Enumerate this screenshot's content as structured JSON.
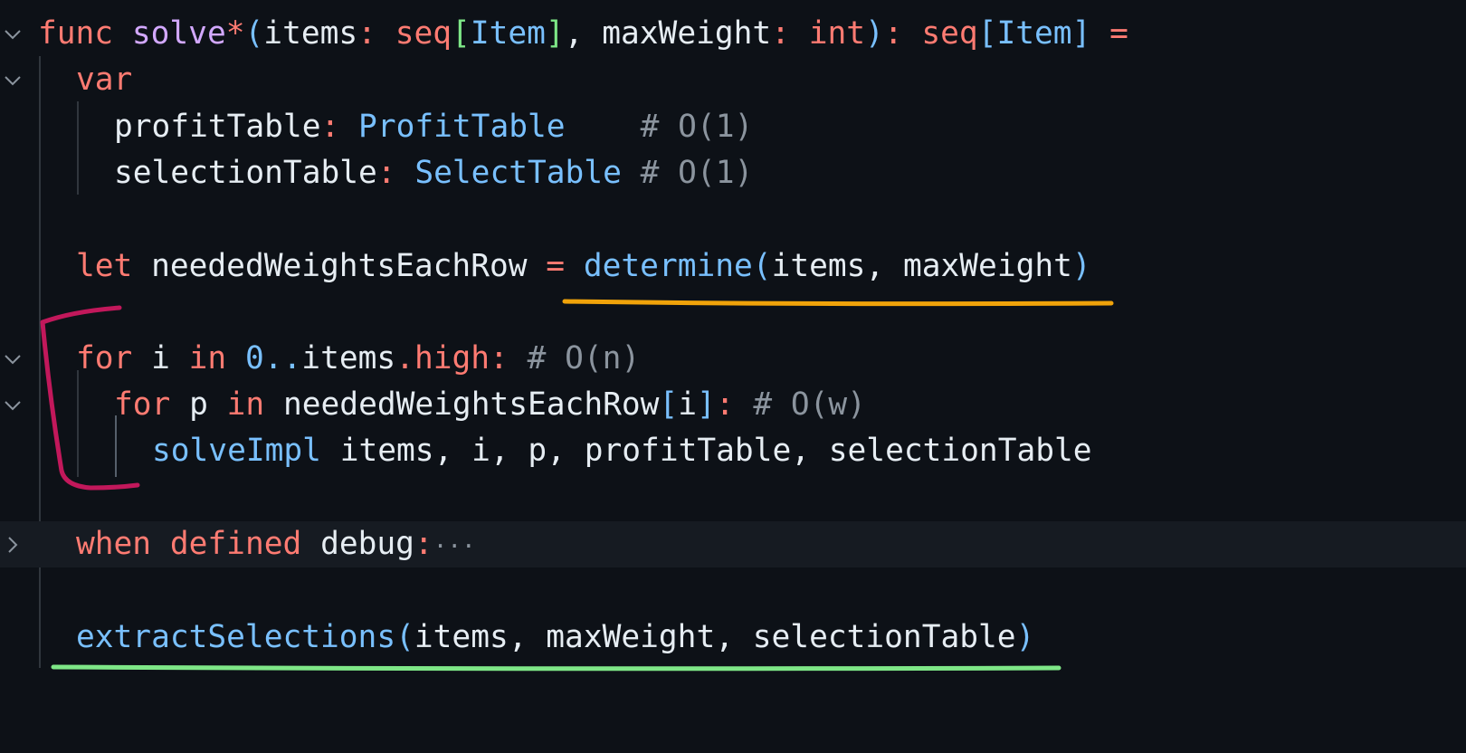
{
  "colors": {
    "background": "#0d1117",
    "keyword": "#ff7b72",
    "function_name": "#d2a8ff",
    "type": "#79c0ff",
    "comment": "#8b949e",
    "identifier": "#e6edf3",
    "annotation_orange": "#f0a30a",
    "annotation_green": "#7ee787",
    "annotation_bracket": "#c2185b"
  },
  "icons": {
    "expanded": "chevron-down-icon",
    "collapsed": "chevron-right-icon"
  },
  "code": {
    "sig": {
      "func": "func",
      "name": "solve",
      "star": "*",
      "p1": "(",
      "items": "items",
      "colon1": ":",
      "seq1": "seq",
      "lb1": "[",
      "item1": "Item",
      "rb1": "]",
      "comma": ", ",
      "maxWeight": "maxWeight",
      "colon2": ":",
      "int": "int",
      "rp": ")",
      "colon3": ":",
      "seq2": "seq",
      "lb2": "[",
      "item2": "Item",
      "rb2": "]",
      "eq": "="
    },
    "var_kw": "var",
    "pt": {
      "name": "profitTable",
      "colon": ":",
      "type": "ProfitTable",
      "pad": "    ",
      "comment": "# O(1)"
    },
    "st": {
      "name": "selectionTable",
      "colon": ":",
      "type": "SelectTable",
      "pad": " ",
      "comment": "# O(1)"
    },
    "let": {
      "kw": "let",
      "name": "neededWeightsEachRow",
      "eq": "=",
      "fn": "determine",
      "p1": "(",
      "args": "items, maxWeight",
      "p2": ")"
    },
    "for1": {
      "kw": "for",
      "var": "i",
      "in": "in",
      "num": "0..",
      "obj": "items",
      "dot": ".",
      "prop": "high",
      "colon": ":",
      "comment": "# O(n)"
    },
    "for2": {
      "kw": "for",
      "var": "p",
      "in": "in",
      "obj": "neededWeightsEachRow",
      "lb": "[",
      "idx": "i",
      "rb": "]",
      "colon": ":",
      "comment": "# O(w)"
    },
    "impl": {
      "fn": "solveImpl",
      "args": "items, i, p, profitTable, selectionTable"
    },
    "when": {
      "kw1": "when",
      "kw2": "defined",
      "ident": "debug",
      "colon": ":",
      "ellipsis": "···"
    },
    "extract": {
      "fn": "extractSelections",
      "p1": "(",
      "args": "items, maxWeight, selectionTable",
      "p2": ")"
    }
  }
}
